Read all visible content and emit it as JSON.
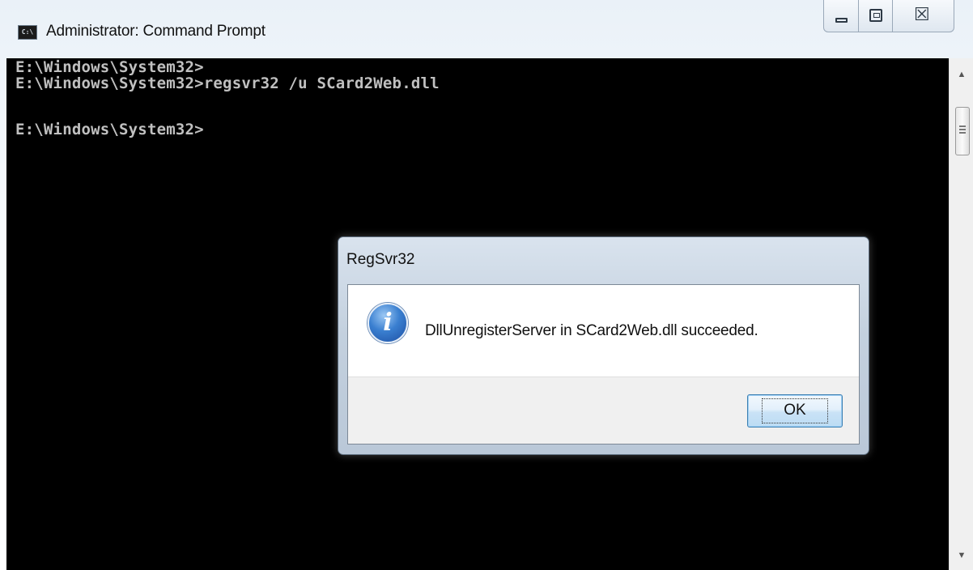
{
  "window": {
    "title": "Administrator: Command Prompt",
    "icon": "cmd-icon",
    "icon_text": "C:\\",
    "caption_buttons": {
      "minimize": "minimize-icon",
      "maximize": "maximize-icon",
      "close": "close-icon",
      "close_glyph": "☒"
    }
  },
  "console": {
    "lines": [
      "E:\\Windows\\System32>",
      "E:\\Windows\\System32>regsvr32 /u SCard2Web.dll",
      "",
      "E:\\Windows\\System32>"
    ],
    "background": "#000000",
    "text_color": "#c0c0c0"
  },
  "scrollbar": {
    "up_arrow": "▲",
    "down_arrow": "▼"
  },
  "dialog": {
    "title": "RegSvr32",
    "icon": "info-icon",
    "icon_glyph": "i",
    "message": "DllUnregisterServer in SCard2Web.dll succeeded.",
    "ok_label": "OK"
  }
}
